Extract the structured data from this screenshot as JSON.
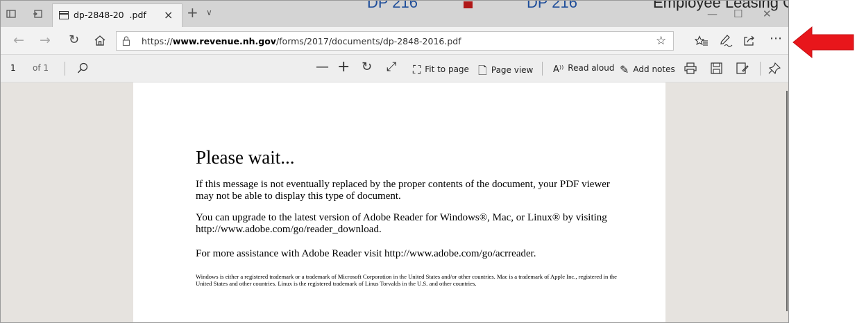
{
  "tabbar": {
    "tab_title": "dp-2848-20  .pdf",
    "tab_close": "×",
    "new_tab": "+",
    "tab_list": "∨",
    "minimize": "—",
    "maximize": "☐",
    "close": "✕",
    "background_headings": [
      "DP 216",
      "DP 216",
      "Employee Leasing Com"
    ]
  },
  "address_bar": {
    "url_prefix": "https://",
    "url_domain": "www.revenue.nh.gov",
    "url_path": "/forms/2017/documents/dp-2848-2016.pdf",
    "icons": [
      "back-icon",
      "forward-icon",
      "refresh-icon",
      "home-icon",
      "lock-icon",
      "favorite-star-icon",
      "favorites-hub-icon",
      "notes-pen-icon",
      "share-icon",
      "more-icon"
    ]
  },
  "pdf_toolbar": {
    "page_number": "1",
    "page_count": "of 1",
    "fit_to_page": "Fit to page",
    "page_view": "Page view",
    "read_aloud": "Read aloud",
    "add_notes": "Add notes"
  },
  "document": {
    "title": "Please wait...",
    "paragraph_1": "If this message is not eventually replaced by the proper contents of the document, your PDF viewer may not be able to display this type of document.",
    "paragraph_2": "You can upgrade to the latest version of Adobe Reader for Windows®, Mac, or Linux® by visiting  http://www.adobe.com/go/reader_download.",
    "paragraph_3": "For more assistance with Adobe Reader visit  http://www.adobe.com/go/acrreader.",
    "fine_print": "Windows is either a registered trademark or a trademark of Microsoft Corporation in the United States and/or other countries. Mac is a trademark of Apple Inc., registered in the United States and other countries. Linux is the registered trademark of Linus Torvalds in the U.S. and other countries."
  },
  "colors": {
    "annotation_arrow": "#e8161b",
    "link_heading": "#1f4e9a",
    "viewer_background": "#e6e3df"
  }
}
